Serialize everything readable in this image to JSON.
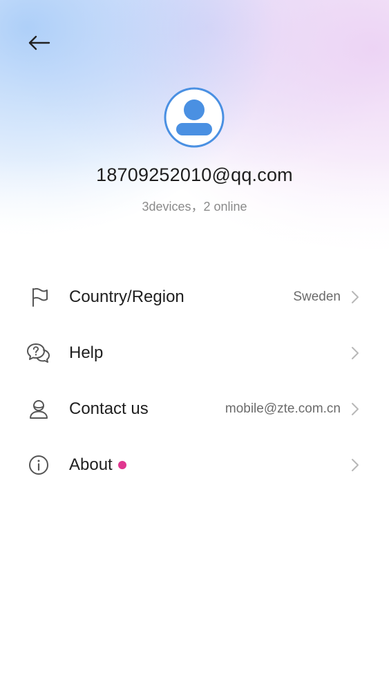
{
  "header": {
    "account_email": "18709252010@qq.com",
    "device_status": "3devices，2 online"
  },
  "menu": {
    "items": [
      {
        "label": "Country/Region",
        "value": "Sweden",
        "icon": "flag-icon"
      },
      {
        "label": "Help",
        "value": "",
        "icon": "help-chat-icon"
      },
      {
        "label": "Contact us",
        "value": "mobile@zte.com.cn",
        "icon": "contact-person-icon"
      },
      {
        "label": "About",
        "value": "",
        "icon": "info-icon",
        "badge": true
      }
    ]
  },
  "colors": {
    "avatar_blue": "#4a90e2",
    "badge_pink": "#e0378f",
    "chevron_gray": "#b8b8b8",
    "icon_gray": "#555555"
  }
}
